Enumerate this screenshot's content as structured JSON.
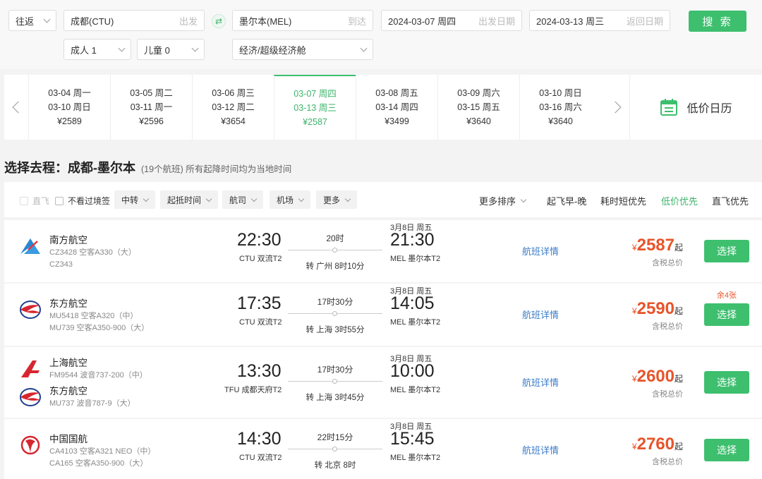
{
  "search": {
    "trip_type": "往返",
    "origin": "成都(CTU)",
    "origin_hint": "出发",
    "destination": "墨尔本(MEL)",
    "destination_hint": "到达",
    "depart_date": "2024-03-07 周四",
    "depart_hint": "出发日期",
    "return_date": "2024-03-13 周三",
    "return_hint": "返回日期",
    "search_label": "搜 索",
    "adults": "成人 1",
    "children": "儿童 0",
    "cabin": "经济/超级经济舱"
  },
  "dates": [
    {
      "out": "03-04 周一",
      "back": "03-10 周日",
      "price": "¥2589"
    },
    {
      "out": "03-05 周二",
      "back": "03-11 周一",
      "price": "¥2596"
    },
    {
      "out": "03-06 周三",
      "back": "03-12 周二",
      "price": "¥3654"
    },
    {
      "out": "03-07 周四",
      "back": "03-13 周三",
      "price": "¥2587"
    },
    {
      "out": "03-08 周五",
      "back": "03-14 周四",
      "price": "¥3499"
    },
    {
      "out": "03-09 周六",
      "back": "03-15 周五",
      "price": "¥3640"
    },
    {
      "out": "03-10 周日",
      "back": "03-16 周六",
      "price": "¥3640"
    }
  ],
  "low_price_calendar": "低价日历",
  "section": {
    "title": "选择去程：成都-墨尔本",
    "subtitle": "(19个航班) 所有起降时间均为当地时间"
  },
  "filters": {
    "direct": "直飞",
    "no_transit_visa": "不看过境签",
    "transfer": "中转",
    "times": "起抵时间",
    "airline": "航司",
    "airport": "机场",
    "more": "更多",
    "more_sort": "更多排序",
    "sort_early": "起飞早-晚",
    "sort_short": "耗时短优先",
    "sort_low": "低价优先",
    "sort_direct": "直飞优先"
  },
  "flights": [
    {
      "airlines": [
        {
          "name": "南方航空",
          "lines": [
            "CZ3428 空客A330（大）",
            "CZ343"
          ]
        }
      ],
      "dep_time": "22:30",
      "dep_airport": "CTU 双流T2",
      "duration": "20时",
      "transfer": "转 广州 8时10分",
      "arr_date": "3月8日 周五",
      "arr_time": "21:30",
      "arr_airport": "MEL 墨尔本T2",
      "detail": "航班详情",
      "price": "2587",
      "yen": "¥",
      "from": "起",
      "tax": "含税总价",
      "remain": "",
      "select": "选择"
    },
    {
      "airlines": [
        {
          "name": "东方航空",
          "lines": [
            "MU5418 空客A320（中）",
            "MU739 空客A350-900（大）"
          ]
        }
      ],
      "dep_time": "17:35",
      "dep_airport": "CTU 双流T2",
      "duration": "17时30分",
      "transfer": "转 上海 3时55分",
      "arr_date": "3月8日 周五",
      "arr_time": "14:05",
      "arr_airport": "MEL 墨尔本T2",
      "detail": "航班详情",
      "price": "2590",
      "yen": "¥",
      "from": "起",
      "tax": "含税总价",
      "remain": "余4张",
      "select": "选择"
    },
    {
      "airlines": [
        {
          "name": "上海航空",
          "lines": [
            "FM9544 波音737-200（中）"
          ]
        },
        {
          "name": "东方航空",
          "lines": [
            "MU737 波音787-9（大）"
          ]
        }
      ],
      "dep_time": "13:30",
      "dep_airport": "TFU 成都天府T2",
      "duration": "17时30分",
      "transfer": "转 上海 3时45分",
      "arr_date": "3月8日 周五",
      "arr_time": "10:00",
      "arr_airport": "MEL 墨尔本T2",
      "detail": "航班详情",
      "price": "2600",
      "yen": "¥",
      "from": "起",
      "tax": "含税总价",
      "remain": "",
      "select": "选择"
    },
    {
      "airlines": [
        {
          "name": "中国国航",
          "lines": [
            "CA4103 空客A321 NEO（中）",
            "CA165 空客A350-900（大）"
          ]
        }
      ],
      "dep_time": "14:30",
      "dep_airport": "CTU 双流T2",
      "duration": "22时15分",
      "transfer": "转 北京 8时",
      "arr_date": "3月8日 周五",
      "arr_time": "15:45",
      "arr_airport": "MEL 墨尔本T2",
      "detail": "航班详情",
      "price": "2760",
      "yen": "¥",
      "from": "起",
      "tax": "含税总价",
      "remain": "",
      "select": "选择"
    }
  ]
}
